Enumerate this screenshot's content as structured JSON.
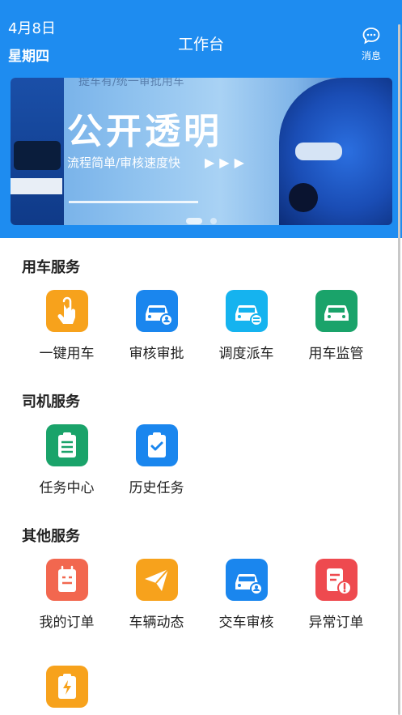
{
  "header": {
    "date": "4月8日",
    "weekday": "星期四",
    "title": "工作台",
    "message_label": "消息",
    "background_color": "#1e8cf0"
  },
  "banner": {
    "top_text": "提车有/统一审批用车",
    "headline": "公开透明",
    "subline": "流程简单/审核速度快",
    "arrows": "▶▶▶"
  },
  "sections": [
    {
      "title": "用车服务",
      "items": [
        {
          "label": "一键用车",
          "icon": "finger-tap-icon",
          "color": "#f7a21c"
        },
        {
          "label": "审核审批",
          "icon": "car-approve-icon",
          "color": "#1a86ee"
        },
        {
          "label": "调度派车",
          "icon": "car-dispatch-icon",
          "color": "#15b3ef"
        },
        {
          "label": "用车监管",
          "icon": "car-monitor-icon",
          "color": "#1aa36a"
        }
      ]
    },
    {
      "title": "司机服务",
      "items": [
        {
          "label": "任务中心",
          "icon": "task-list-icon",
          "color": "#1aa36a"
        },
        {
          "label": "历史任务",
          "icon": "clipboard-check-icon",
          "color": "#1a86ee"
        }
      ]
    },
    {
      "title": "其他服务",
      "items": [
        {
          "label": "我的订单",
          "icon": "order-icon",
          "color": "#f2674f"
        },
        {
          "label": "车辆动态",
          "icon": "paper-plane-icon",
          "color": "#f7a21c"
        },
        {
          "label": "交车审核",
          "icon": "car-return-icon",
          "color": "#1a86ee"
        },
        {
          "label": "异常订单",
          "icon": "abnormal-order-icon",
          "color": "#ee4a4f"
        },
        {
          "label": "",
          "icon": "charge-icon",
          "color": "#f7a21c"
        }
      ]
    }
  ]
}
